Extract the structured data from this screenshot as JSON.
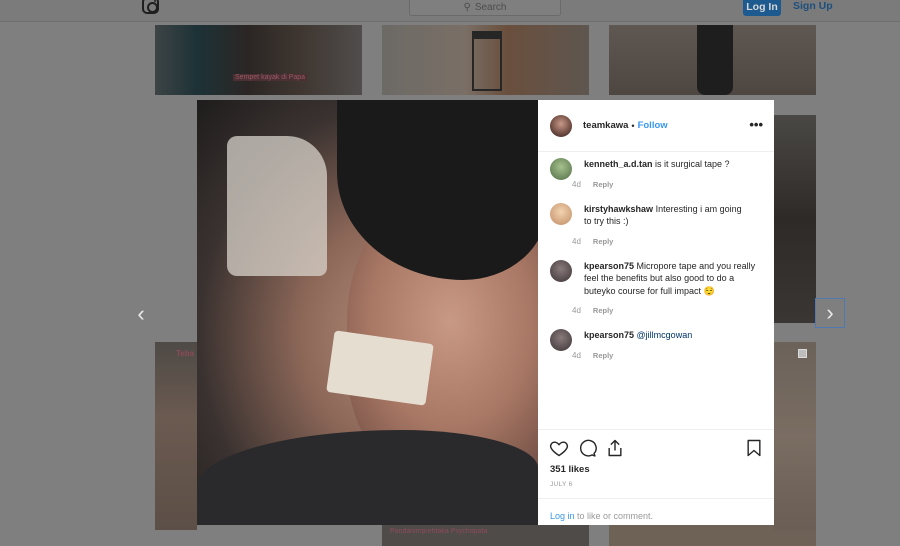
{
  "topbar": {
    "search_placeholder": "Search",
    "login_label": "Log In",
    "signup_label": "Sign Up"
  },
  "background_grid": {
    "thumb1_caption": "Sempet kayak di Papa",
    "thumb4_caption": "Teba",
    "thumb5_caption": "Pandanimprehtaka Psychopata"
  },
  "modal": {
    "header": {
      "username": "teamkawa",
      "separator": "•",
      "follow_label": "Follow",
      "more_icon": "more-options-icon"
    },
    "comments": [
      {
        "user": "kenneth_a.d.tan",
        "text": "is it surgical tape ?",
        "age": "4d",
        "reply_label": "Reply",
        "avatar_color": "#6a8f5d"
      },
      {
        "user": "kirstyhawkshaw",
        "text": "Interesting i am going to try this :)",
        "age": "4d",
        "reply_label": "Reply",
        "avatar_color": "#d9b48f"
      },
      {
        "user": "kpearson75",
        "text": "Micropore tape and you really feel the benefits but also good to do a buteyko course for full impact 😌",
        "age": "4d",
        "reply_label": "Reply",
        "avatar_color": "#5b5152"
      },
      {
        "user": "kpearson75",
        "mention": "@jillmcgowan",
        "age": "4d",
        "reply_label": "Reply",
        "avatar_color": "#5b5152"
      }
    ],
    "likes": "351 likes",
    "date": "JULY 6",
    "login_prompt": {
      "link": "Log in",
      "text": " to like or comment."
    }
  }
}
